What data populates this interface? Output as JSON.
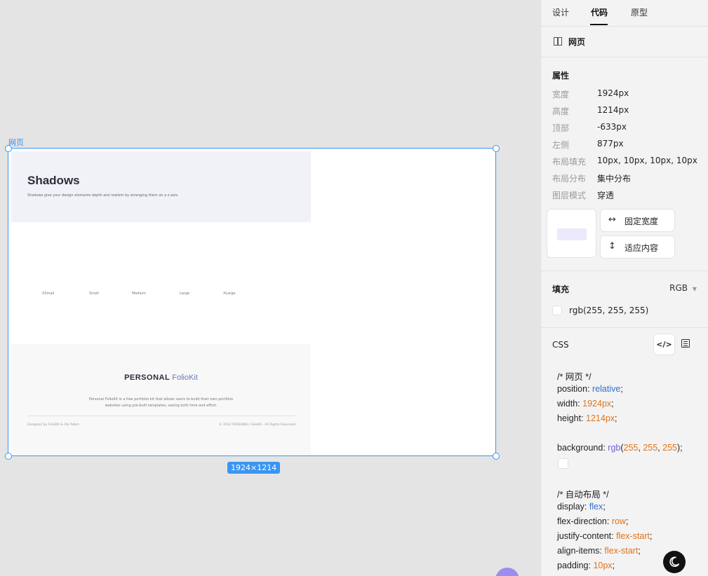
{
  "canvas": {
    "frame_label": "网页",
    "size_badge": "1924×1214",
    "page": {
      "hero_title": "Shadows",
      "hero_subtitle": "Shadows give your design elements depth and realism by arranging them on a z-axis.",
      "sizes": [
        "XSmall",
        "Small",
        "Medium",
        "Large",
        "XLarge"
      ],
      "brand_bold": "PERSONAL",
      "brand_light": "FolioKit",
      "footer_desc": "Personal FolioKit is a free portfolio kit that allows users to build their own portfolio websites using pre-built templates, saving both time and effort.",
      "footer_left": "Designed by FolioKit & Ala Adam",
      "footer_right": "© 2022 PERSONAL FolioKit - All Rights Reserved"
    }
  },
  "panel": {
    "tabs": [
      {
        "label": "设计",
        "active": false
      },
      {
        "label": "代码",
        "active": true
      },
      {
        "label": "原型",
        "active": false
      }
    ],
    "node_name": "网页",
    "properties_title": "属性",
    "properties": [
      {
        "label": "宽度",
        "value": "1924px"
      },
      {
        "label": "高度",
        "value": "1214px"
      },
      {
        "label": "顶部",
        "value": "-633px"
      },
      {
        "label": "左侧",
        "value": "877px"
      },
      {
        "label": "布局填充",
        "value": "10px, 10px, 10px, 10px"
      },
      {
        "label": "布局分布",
        "value": "集中分布"
      },
      {
        "label": "图层模式",
        "value": "穿透"
      }
    ],
    "fixed_width_label": "固定宽度",
    "fit_content_label": "适应内容",
    "fill_title": "填充",
    "fill_mode": "RGB",
    "fill_value": "rgb(255, 255, 255)",
    "css_title": "CSS",
    "code": {
      "comment1": "/* 网页 */",
      "position_key": "position: ",
      "position_val": "relative",
      "width_key": "width: ",
      "width_val": "1924px",
      "height_key": "height: ",
      "height_val": "1214px",
      "bg_key": "background: ",
      "bg_fn": "rgb",
      "bg_r": "255",
      "bg_g": "255",
      "bg_b": "255",
      "comment2": "/* 自动布局 */",
      "display_key": "display: ",
      "display_val": "flex",
      "fd_key": "flex-direction: ",
      "fd_val": "row",
      "jc_key": "justify-content: ",
      "jc_val": "flex-start",
      "ai_key": "align-items: ",
      "ai_val": "flex-start",
      "pad_key": "padding: ",
      "pad_val": "10px"
    }
  },
  "colors": {
    "selection": "#3a95f2",
    "comment": "#3aa63a",
    "keyword": "#2f6fcf",
    "number": "#e0731a"
  }
}
